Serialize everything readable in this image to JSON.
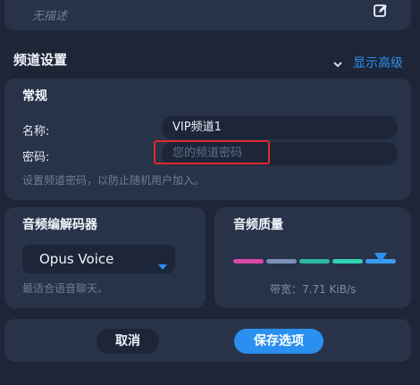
{
  "top": {
    "description_placeholder": "无描述",
    "edit_icon": "edit-icon"
  },
  "channel_settings": {
    "title": "频道设置",
    "show_advanced": "显示高级",
    "chevron_icon": "chevron-down-icon"
  },
  "general": {
    "title": "常规",
    "name_label": "名称:",
    "name_value": "VIP频道1",
    "password_label": "密码:",
    "password_placeholder": "您的频道密码",
    "hint": "设置频道密码，以防止随机用户加入。"
  },
  "codec": {
    "title": "音频编解码器",
    "selected": "Opus Voice",
    "hint": "最适合语音聊天。",
    "dropdown_icon": "caret-down-icon"
  },
  "quality": {
    "title": "音频质量",
    "bandwidth": "带宽：7.71 KiB/s",
    "level_fraction": 0.89,
    "colors": [
      "#d84aa8",
      "#7c8fb6",
      "#2fb9a1",
      "#2fd0b0",
      "#3a9df0"
    ]
  },
  "actions": {
    "cancel": "取消",
    "save": "保存选项"
  },
  "colors": {
    "accent": "#2b8ff0",
    "highlight_box": "#e02a2a"
  }
}
